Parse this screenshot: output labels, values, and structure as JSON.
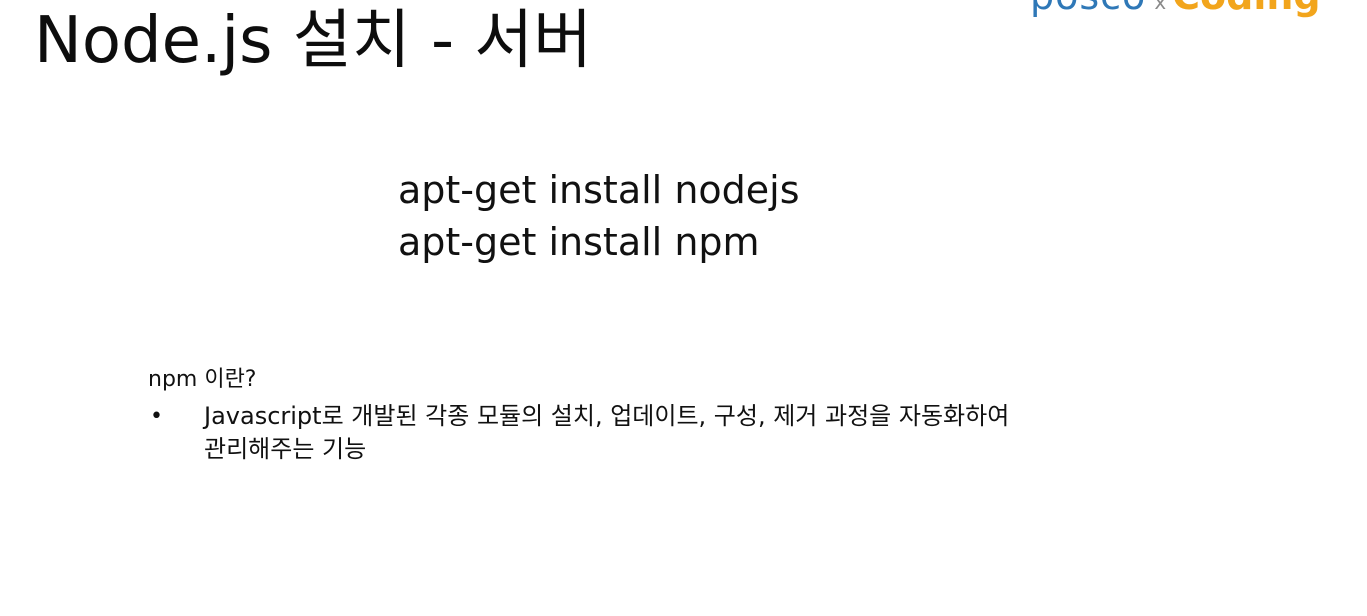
{
  "slide": {
    "title": "Node.js 설치 - 서버",
    "logo": {
      "left_text": "posco",
      "separator": "x",
      "right_text": "Coding",
      "left_color": "#2f78b7",
      "right_color": "#f2a51c"
    },
    "commands": [
      "apt-get install nodejs",
      "apt-get install npm"
    ],
    "note": {
      "heading": "npm 이란?",
      "bullets": [
        {
          "marker": "•",
          "line1": "Javascript로 개발된 각종 모듈의 설치, 업데이트, 구성, 제거 과정을 자동화하여",
          "line2": "관리해주는 기능"
        }
      ]
    }
  }
}
